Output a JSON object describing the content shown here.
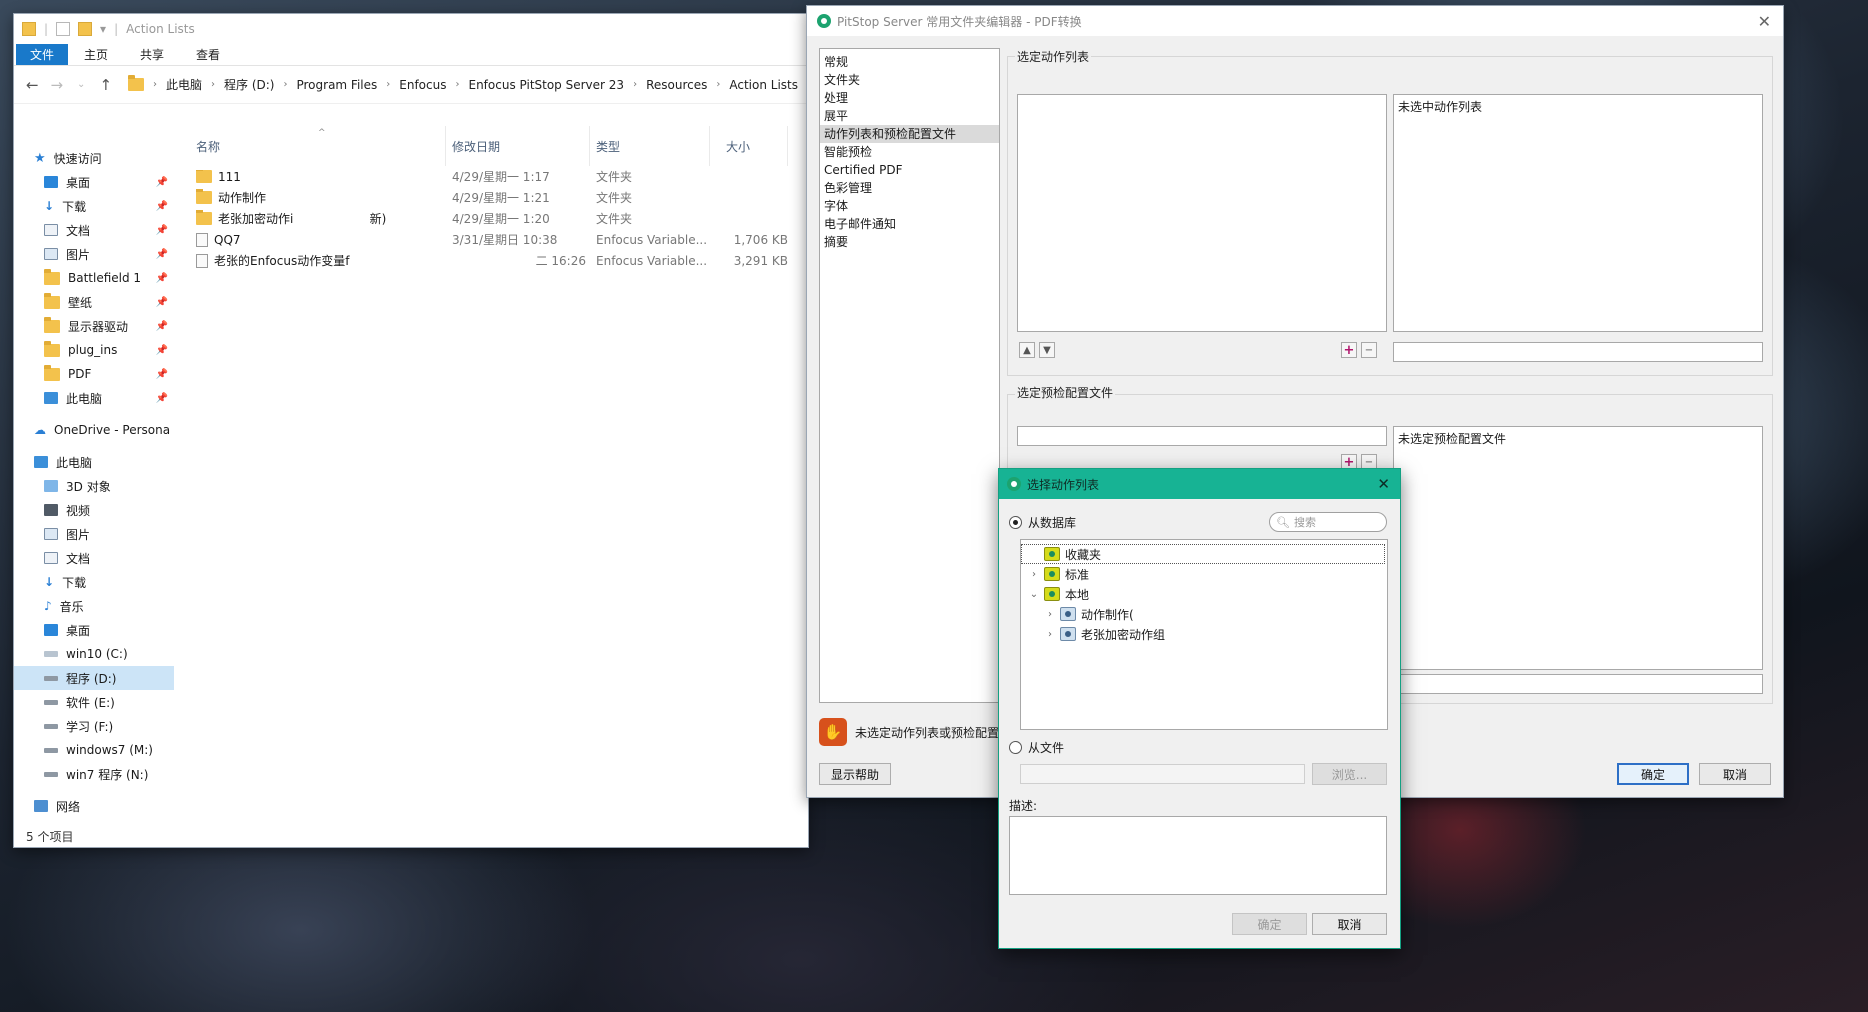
{
  "explorer": {
    "title": "Action Lists",
    "ribbon": [
      "文件",
      "主页",
      "共享",
      "查看"
    ],
    "breadcrumbs": [
      "此电脑",
      "程序 (D:)",
      "Program Files",
      "Enfocus",
      "Enfocus PitStop Server 23",
      "Resources",
      "Action Lists"
    ],
    "nav": {
      "quick_access": "快速访问",
      "quick_items": [
        "桌面",
        "下载",
        "文档",
        "图片",
        "Battlefield 1",
        "壁纸",
        "显示器驱动",
        "plug_ins",
        "PDF",
        "此电脑"
      ],
      "onedrive": "OneDrive - Persona",
      "this_pc": "此电脑",
      "pc_items": [
        "3D 对象",
        "视频",
        "图片",
        "文档",
        "下载",
        "音乐",
        "桌面",
        "win10 (C:)",
        "程序 (D:)",
        "软件 (E:)",
        "学习 (F:)",
        "windows7 (M:)",
        "win7 程序 (N:)"
      ],
      "network": "网络"
    },
    "columns": {
      "name": "名称",
      "date": "修改日期",
      "type": "类型",
      "size": "大小"
    },
    "files": [
      {
        "name": "111",
        "date": "4/29/星期一 1:17",
        "type": "文件夹",
        "size": "",
        "kind": "folder"
      },
      {
        "name": "动作制作",
        "date": "4/29/星期一 1:21",
        "type": "文件夹",
        "size": "",
        "kind": "folder"
      },
      {
        "name": "老张加密动作i                    新)",
        "date": "4/29/星期一 1:20",
        "type": "文件夹",
        "size": "",
        "kind": "folder"
      },
      {
        "name": "QQ7",
        "date": "3/31/星期日 10:38",
        "type": "Enfocus Variable...",
        "size": "1,706 KB",
        "kind": "file"
      },
      {
        "name": "老张的Enfocus动作变量f",
        "date": "二 16:26",
        "type": "Enfocus Variable...",
        "size": "3,291 KB",
        "kind": "file"
      }
    ],
    "status": "5 个项目"
  },
  "pitstop": {
    "title": "PitStop Server 常用文件夹编辑器 - PDF转换",
    "categories": [
      "常规",
      "文件夹",
      "处理",
      "展平",
      "动作列表和预检配置文件",
      "智能预检",
      "Certified PDF",
      "色彩管理",
      "字体",
      "电子邮件通知",
      "摘要"
    ],
    "selected_category": 4,
    "action_list_label": "选定动作列表",
    "no_action_list": "未选中动作列表",
    "preflight_label": "选定预检配置文件",
    "no_preflight": "未选定预检配置文件",
    "warning": "未选定动作列表或预检配置",
    "help_button": "显示帮助",
    "ok_button": "确定",
    "cancel_button": "取消"
  },
  "select_dialog": {
    "title": "选择动作列表",
    "from_database": "从数据库",
    "search_placeholder": "搜索",
    "tree": [
      {
        "label": "收藏夹",
        "level": 0,
        "twisty": "",
        "icon": "db"
      },
      {
        "label": "标准",
        "level": 0,
        "twisty": "›",
        "icon": "db"
      },
      {
        "label": "本地",
        "level": 0,
        "twisty": "⌄",
        "icon": "db"
      },
      {
        "label": "动作制作(",
        "level": 1,
        "twisty": "›",
        "icon": "al"
      },
      {
        "label": "老张加密动作组",
        "level": 1,
        "twisty": "›",
        "icon": "al"
      }
    ],
    "from_file": "从文件",
    "browse_button": "浏览...",
    "description_label": "描述:",
    "ok_button": "确定",
    "cancel_button": "取消"
  }
}
